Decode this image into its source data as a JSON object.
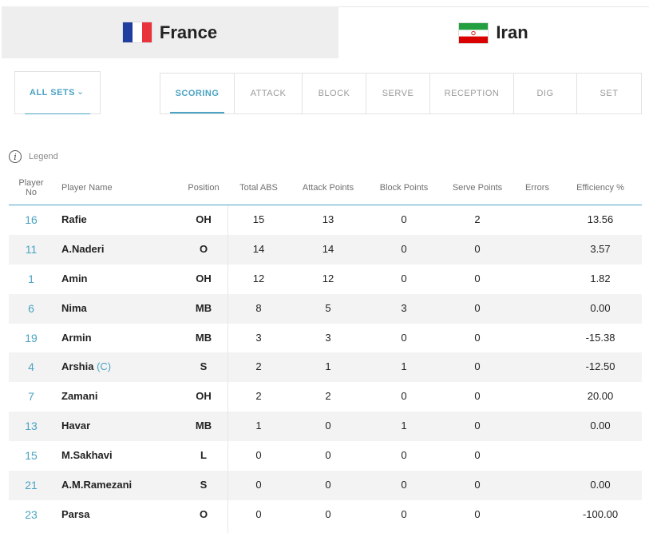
{
  "teams": [
    {
      "name": "France",
      "flag": "france-flag"
    },
    {
      "name": "Iran",
      "flag": "iran-flag"
    }
  ],
  "sets_filter": {
    "label": "ALL SETS"
  },
  "stat_tabs": [
    "SCORING",
    "ATTACK",
    "BLOCK",
    "SERVE",
    "RECEPTION",
    "DIG",
    "SET"
  ],
  "legend": {
    "label": "Legend"
  },
  "columns": {
    "player_no_1": "Player",
    "player_no_2": "No",
    "player_name": "Player Name",
    "position": "Position",
    "total_abs": "Total ABS",
    "attack_points": "Attack Points",
    "block_points": "Block Points",
    "serve_points": "Serve Points",
    "errors": "Errors",
    "efficiency": "Efficiency %"
  },
  "players": [
    {
      "no": "16",
      "name": "Rafie",
      "captain": "",
      "pos": "OH",
      "abs": "15",
      "att": "13",
      "blk": "0",
      "srv": "2",
      "err": "",
      "eff": "13.56"
    },
    {
      "no": "11",
      "name": "A.Naderi",
      "captain": "",
      "pos": "O",
      "abs": "14",
      "att": "14",
      "blk": "0",
      "srv": "0",
      "err": "",
      "eff": "3.57"
    },
    {
      "no": "1",
      "name": "Amin",
      "captain": "",
      "pos": "OH",
      "abs": "12",
      "att": "12",
      "blk": "0",
      "srv": "0",
      "err": "",
      "eff": "1.82"
    },
    {
      "no": "6",
      "name": "Nima",
      "captain": "",
      "pos": "MB",
      "abs": "8",
      "att": "5",
      "blk": "3",
      "srv": "0",
      "err": "",
      "eff": "0.00"
    },
    {
      "no": "19",
      "name": "Armin",
      "captain": "",
      "pos": "MB",
      "abs": "3",
      "att": "3",
      "blk": "0",
      "srv": "0",
      "err": "",
      "eff": "-15.38"
    },
    {
      "no": "4",
      "name": "Arshia",
      "captain": "(C)",
      "pos": "S",
      "abs": "2",
      "att": "1",
      "blk": "1",
      "srv": "0",
      "err": "",
      "eff": "-12.50"
    },
    {
      "no": "7",
      "name": "Zamani",
      "captain": "",
      "pos": "OH",
      "abs": "2",
      "att": "2",
      "blk": "0",
      "srv": "0",
      "err": "",
      "eff": "20.00"
    },
    {
      "no": "13",
      "name": "Havar",
      "captain": "",
      "pos": "MB",
      "abs": "1",
      "att": "0",
      "blk": "1",
      "srv": "0",
      "err": "",
      "eff": "0.00"
    },
    {
      "no": "15",
      "name": "M.Sakhavi",
      "captain": "",
      "pos": "L",
      "abs": "0",
      "att": "0",
      "blk": "0",
      "srv": "0",
      "err": "",
      "eff": ""
    },
    {
      "no": "21",
      "name": "A.M.Ramezani",
      "captain": "",
      "pos": "S",
      "abs": "0",
      "att": "0",
      "blk": "0",
      "srv": "0",
      "err": "",
      "eff": "0.00"
    },
    {
      "no": "23",
      "name": "Parsa",
      "captain": "",
      "pos": "O",
      "abs": "0",
      "att": "0",
      "blk": "0",
      "srv": "0",
      "err": "",
      "eff": "-100.00"
    }
  ],
  "colors": {
    "accent": "#4ba3c3",
    "france_blue": "#1f3ea0",
    "france_red": "#e8323c",
    "iran_green": "#239f40",
    "iran_red": "#da0000"
  }
}
